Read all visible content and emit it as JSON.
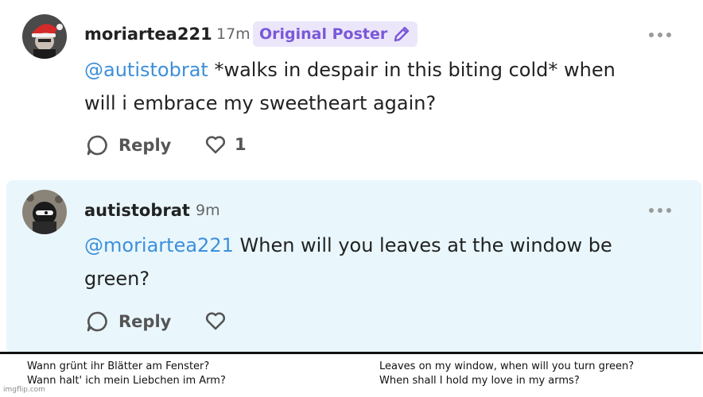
{
  "comments": [
    {
      "username": "moriartea221",
      "time_ago": "17m",
      "badge": "Original Poster",
      "mention": "@autistobrat",
      "text_line1": " *walks in despair in this biting cold* when",
      "text_line2": "will i embrace my sweetheart again?",
      "reply_label": "Reply",
      "like_count": "1"
    },
    {
      "username": "autistobrat",
      "time_ago": "9m",
      "mention": "@moriartea221",
      "text_line1": " When will you leaves at the window be",
      "text_line2": "green?",
      "reply_label": "Reply"
    }
  ],
  "caption": {
    "german_line1": "Wann grünt ihr Blätter am Fenster?",
    "german_line2": "Wann halt' ich mein Liebchen im Arm?",
    "english_line1": "Leaves on my window, when will you turn green?",
    "english_line2": "When shall I hold my love in my arms?"
  },
  "watermark": "imgflip.com",
  "colors": {
    "mention": "#3d8fd9",
    "badge_text": "#7a58d8",
    "badge_bg": "#ece6fb",
    "highlight_bg": "#e9f7fd"
  },
  "icons": [
    "pencil-icon",
    "reply-bubble-icon",
    "heart-icon",
    "more-options-icon",
    "santa-hat-icon"
  ]
}
